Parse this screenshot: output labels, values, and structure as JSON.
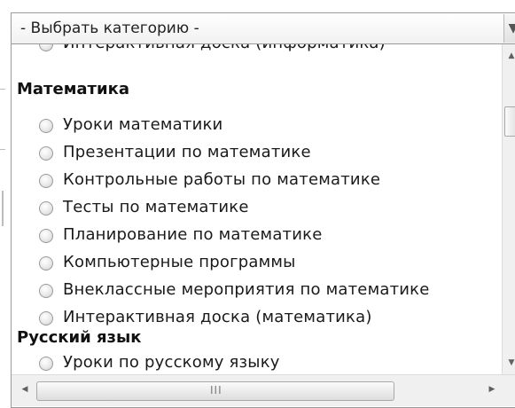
{
  "dropdown": {
    "selected": "- Выбрать категорию -",
    "arrow_icon": "chevron-down-icon"
  },
  "list": {
    "rows": [
      {
        "type": "option",
        "label": "Интерактивная доска (информатика)"
      },
      {
        "type": "group",
        "label": "Математика"
      },
      {
        "type": "option",
        "label": "Уроки математики"
      },
      {
        "type": "option",
        "label": "Презентации по математике"
      },
      {
        "type": "option",
        "label": "Контрольные работы по математике"
      },
      {
        "type": "option",
        "label": "Тесты по математике"
      },
      {
        "type": "option",
        "label": "Планирование по математике"
      },
      {
        "type": "option",
        "label": "Компьютерные программы"
      },
      {
        "type": "option",
        "label": "Внеклассные мероприятия по математике"
      },
      {
        "type": "option",
        "label": "Интерактивная доска (математика)"
      },
      {
        "type": "group",
        "label": "Русский язык"
      },
      {
        "type": "option",
        "label": "Уроки по русскому языку"
      }
    ]
  },
  "scrollbars": {
    "up_icon": "▲",
    "down_icon": "▼",
    "left_icon": "◀",
    "right_icon": "▶",
    "grip": "III"
  }
}
